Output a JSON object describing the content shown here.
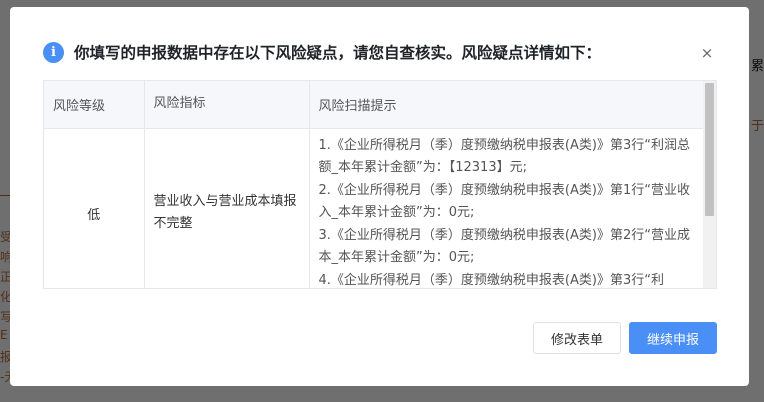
{
  "dialog": {
    "title": "你填写的申报数据中存在以下风险疑点，请您自查核实。风险疑点详情如下：",
    "info_icon": "i",
    "close_icon": "×"
  },
  "table": {
    "headers": [
      "风险等级",
      "风险指标",
      "风险扫描提示"
    ],
    "rows": [
      {
        "level": "低",
        "indicator": "营业收入与营业成本填报不完整",
        "hints": [
          "1.《企业所得税月（季）度预缴纳税申报表(A类)》第3行“利润总额_本年累计金额”为：【12313】元;",
          "2.《企业所得税月（季）度预缴纳税申报表(A类)》第1行“营业收入_本年累计金额”为：0元;",
          "3.《企业所得税月（季）度预缴纳税申报表(A类)》第2行“营业成本_本年累计金额”为：0元;",
          "4.《企业所得税月（季）度预缴纳税申报表(A类)》第3行“利"
        ]
      }
    ]
  },
  "buttons": {
    "modify": "修改表单",
    "continue": "继续申报"
  },
  "background": {
    "right_fragment_top": "累",
    "right_fragment_mid": "于",
    "left_fragments": [
      "受",
      "响",
      "正",
      "化",
      "写",
      "E",
      "报",
      "-无"
    ]
  },
  "colors": {
    "accent": "#4a8ff5",
    "header_bg": "#f5f7fa",
    "border": "#e4e7ed"
  }
}
